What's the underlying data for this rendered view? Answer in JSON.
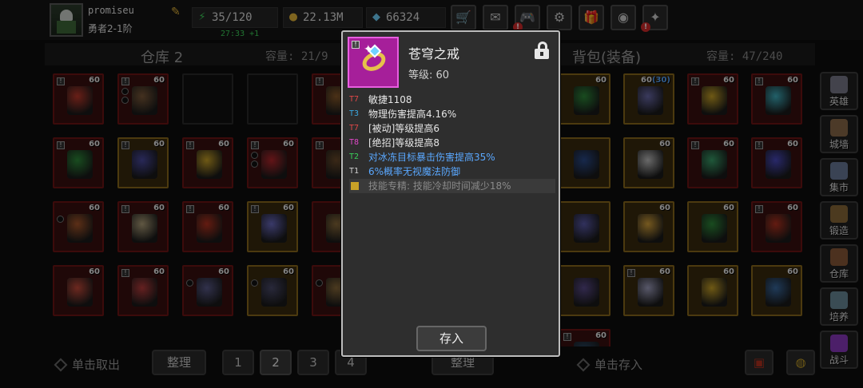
{
  "player": {
    "name": "promiseu",
    "rank": "勇者2-1阶"
  },
  "stats": {
    "energy": "35/120",
    "energy_timer": "27:33 +1",
    "gold": "22.13M",
    "gems": "66324"
  },
  "top_buttons": [
    "cart-icon",
    "mail-icon",
    "gamepad-icon",
    "gear-icon",
    "gift-icon",
    "wheel-icon",
    "sparkle-icon"
  ],
  "warehouse": {
    "title": "仓库 2",
    "capacity": "容量: 21/9"
  },
  "backpack": {
    "title": "背包(装备)",
    "capacity": "容量: 47/240"
  },
  "warehouse_slots": [
    {
      "lvl": "60",
      "mark": true,
      "dots": 0,
      "color": "#c0392b"
    },
    {
      "lvl": "60",
      "mark": true,
      "dots": 2,
      "color": "#7d5a3a"
    },
    {
      "empty": true
    },
    {
      "empty": true
    },
    {
      "lvl": "",
      "mark": true,
      "dots": 0,
      "color": "#8a5a2a"
    },
    {
      "lvl": "60",
      "mark": true,
      "dots": 0,
      "color": "#2e8b3a"
    },
    {
      "lvl": "60",
      "mark": true,
      "dots": 0,
      "color": "#4a4aa0",
      "gold": true
    },
    {
      "lvl": "60",
      "mark": true,
      "dots": 0,
      "color": "#c9a227"
    },
    {
      "lvl": "60",
      "mark": true,
      "dots": 2,
      "color": "#b3262b"
    },
    {
      "lvl": "",
      "mark": true,
      "dots": 0,
      "color": "#6a4a2a"
    },
    {
      "lvl": "60",
      "mark": false,
      "dots": 1,
      "color": "#a8562a"
    },
    {
      "lvl": "60",
      "mark": true,
      "dots": 0,
      "color": "#b0a07a"
    },
    {
      "lvl": "60",
      "mark": true,
      "dots": 0,
      "color": "#b5321f"
    },
    {
      "lvl": "60",
      "mark": true,
      "dots": 0,
      "color": "#6a6ac0",
      "gold": true
    },
    {
      "lvl": "",
      "mark": false,
      "dots": 0,
      "color": "#8a6a3a"
    },
    {
      "lvl": "60",
      "mark": false,
      "dots": 0,
      "color": "#c64a3a"
    },
    {
      "lvl": "60",
      "mark": true,
      "dots": 0,
      "color": "#b83c3c"
    },
    {
      "lvl": "60",
      "mark": false,
      "dots": 1,
      "color": "#5a5a8a"
    },
    {
      "lvl": "60",
      "mark": false,
      "dots": 1,
      "color": "#4a4a6a",
      "gold": true
    },
    {
      "lvl": "",
      "mark": false,
      "dots": 1,
      "color": "#8a6a3a"
    }
  ],
  "backpack_slots": [
    {
      "lvl": "60",
      "mark": false,
      "dots": 0,
      "color": "#2e8a3a",
      "gold": true
    },
    {
      "lvl": "60",
      "lvl_ext": "(30)",
      "mark": false,
      "dots": 0,
      "color": "#6a6aaa",
      "gold": true
    },
    {
      "lvl": "60",
      "mark": true,
      "dots": 0,
      "color": "#c9a227"
    },
    {
      "lvl": "60",
      "mark": true,
      "dots": 0,
      "color": "#3fb0c0"
    },
    {
      "lvl": "",
      "mark": false,
      "dots": 0,
      "color": "#2a4a8a",
      "gold": true
    },
    {
      "lvl": "60",
      "mark": false,
      "dots": 0,
      "color": "#c0c0c0",
      "gold": true
    },
    {
      "lvl": "60",
      "mark": true,
      "dots": 0,
      "color": "#3aa06a"
    },
    {
      "lvl": "60",
      "mark": true,
      "dots": 0,
      "color": "#4a4ac0"
    },
    {
      "lvl": "",
      "mark": false,
      "dots": 0,
      "color": "#5a5aaa",
      "gold": true
    },
    {
      "lvl": "60",
      "mark": false,
      "dots": 0,
      "color": "#d6a23a",
      "gold": true
    },
    {
      "lvl": "60",
      "mark": false,
      "dots": 0,
      "color": "#2e8a3a",
      "gold": true
    },
    {
      "lvl": "60",
      "mark": true,
      "dots": 0,
      "color": "#b5321f"
    },
    {
      "lvl": "",
      "mark": false,
      "dots": 0,
      "color": "#5a4a8a",
      "gold": true
    },
    {
      "lvl": "60",
      "mark": true,
      "dots": 0,
      "color": "#a0a0c0",
      "gold": true
    },
    {
      "lvl": "60",
      "mark": false,
      "dots": 0,
      "color": "#c9a227",
      "gold": true
    },
    {
      "lvl": "60",
      "mark": false,
      "dots": 0,
      "color": "#3a6aa0",
      "gold": true
    },
    {
      "lvl": "60",
      "mark": true,
      "dots": 0,
      "color": "#2a4a6a"
    }
  ],
  "popup": {
    "item_name": "苍穹之戒",
    "item_level": "等级: 60",
    "store_label": "存入",
    "attributes": [
      {
        "tier": "T7",
        "text": "敏捷1108",
        "tier_color": "#e04848",
        "text_color": "#e6e6e6"
      },
      {
        "tier": "T3",
        "text": "物理伤害提高4.16%",
        "tier_color": "#3aa8e0",
        "text_color": "#e6e6e6"
      },
      {
        "tier": "T7",
        "text": "[被动]等级提高6",
        "tier_color": "#e04848",
        "text_color": "#e6e6e6"
      },
      {
        "tier": "T8",
        "text": "[绝招]等级提高8",
        "tier_color": "#e048c8",
        "text_color": "#e6e6e6"
      },
      {
        "tier": "T2",
        "text": "对冰冻目标暴击伤害提高35%",
        "tier_color": "#3ad05a",
        "text_color": "#5aa8ff"
      },
      {
        "tier": "T1",
        "text": "6%概率无视魔法防御",
        "tier_color": "#d0d0d0",
        "text_color": "#5aa8ff"
      }
    ],
    "skill_line": "技能专精: 技能冷却时间减少18%"
  },
  "bottom": {
    "take_out_hint": "单击取出",
    "sort_left": "整理",
    "pages": [
      "1",
      "2",
      "3",
      "4"
    ],
    "active_page": "2",
    "sort_right": "整理",
    "store_hint": "单击存入"
  },
  "side_nav": [
    {
      "label": "英雄",
      "icon_color": "#7a7a8a"
    },
    {
      "label": "城墙",
      "icon_color": "#8a6a4a"
    },
    {
      "label": "集市",
      "icon_color": "#6a7a9a"
    },
    {
      "label": "锻造",
      "icon_color": "#8a6a3a"
    },
    {
      "label": "仓库",
      "icon_color": "#8a5a3a"
    },
    {
      "label": "培养",
      "icon_color": "#6a8a9a"
    },
    {
      "label": "战斗",
      "icon_color": "#8a3ac0"
    }
  ],
  "colors": {
    "slot_red": "#6d1515",
    "slot_gold": "#8a6a1c",
    "popup_icon_bg": "#a61f9a",
    "timer_green": "#3cd25a"
  }
}
